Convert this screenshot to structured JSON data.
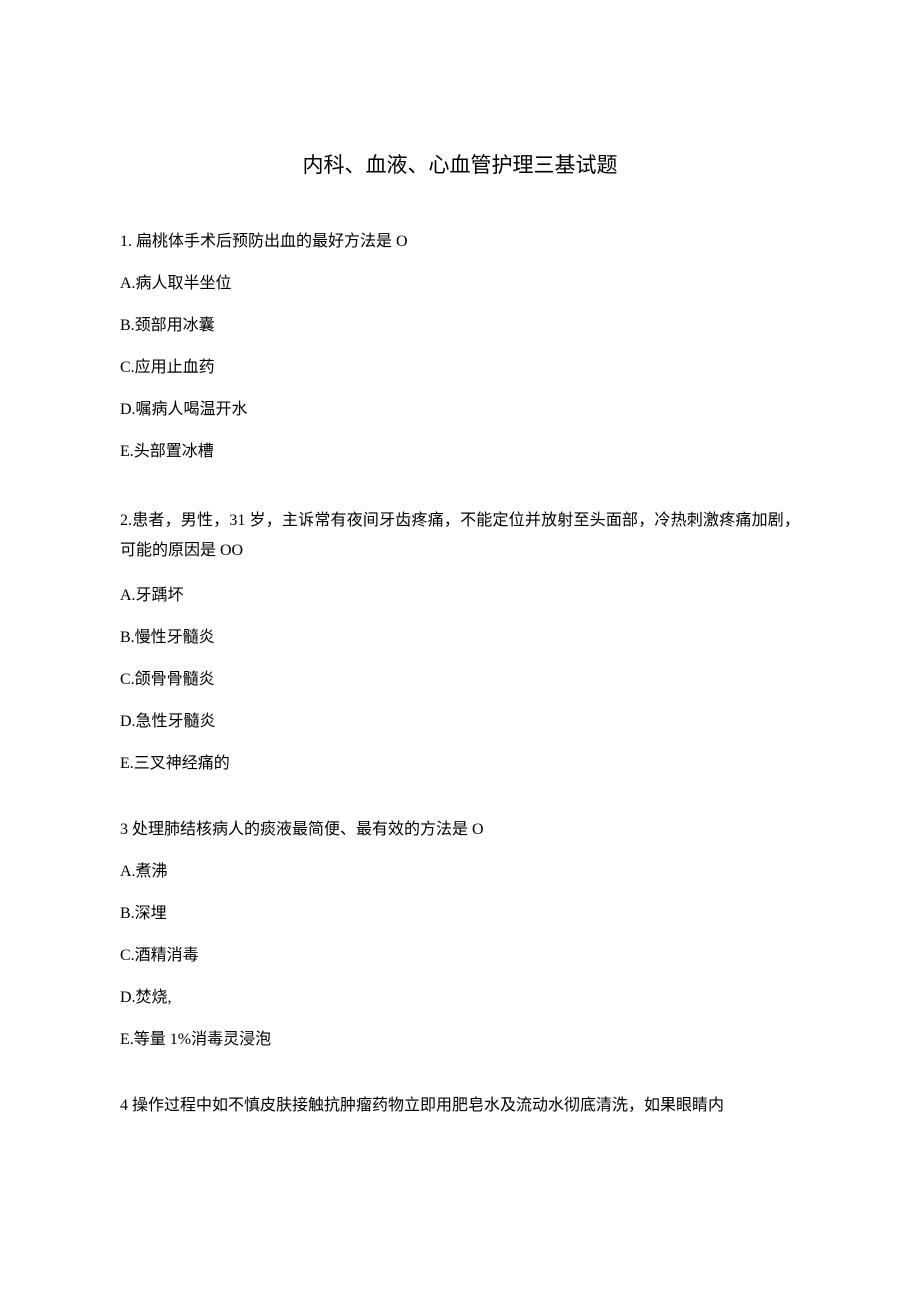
{
  "title": "内科、血液、心血管护理三基试题",
  "questions": [
    {
      "stem": "1. 扁桃体手术后预防出血的最好方法是 O",
      "options": [
        "A.病人取半坐位",
        "B.颈部用冰囊",
        "C.应用止血药",
        "D.嘱病人喝温开水",
        "E.头部置冰槽"
      ]
    },
    {
      "stem": "2.患者，男性，31 岁，主诉常有夜间牙齿疼痛，不能定位并放射至头面部，冷热刺激疼痛加剧，可能的原因是 OO",
      "options": [
        "A.牙踽坏",
        "B.慢性牙髓炎",
        "C.颌骨骨髓炎",
        "D.急性牙髓炎",
        "E.三叉神经痛的"
      ]
    },
    {
      "stem": "3 处理肺结核病人的痰液最简便、最有效的方法是 O",
      "options": [
        "A.煮沸",
        "B.深埋",
        "C.酒精消毒",
        "D.焚烧,",
        "E.等量 1%消毒灵浸泡"
      ]
    },
    {
      "stem": "4 操作过程中如不慎皮肤接触抗肿瘤药物立即用肥皂水及流动水彻底清洗，如果眼睛内",
      "options": []
    }
  ]
}
